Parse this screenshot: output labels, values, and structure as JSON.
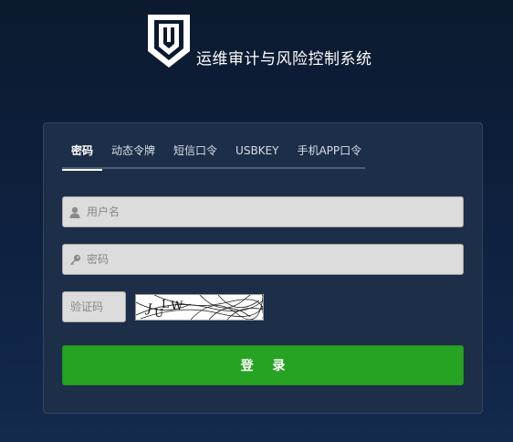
{
  "header": {
    "logo_icon": "shield-logo-icon",
    "title": "运维审计与风险控制系统"
  },
  "tabs": [
    {
      "label": "密码",
      "active": true
    },
    {
      "label": "动态令牌",
      "active": false
    },
    {
      "label": "短信口令",
      "active": false
    },
    {
      "label": "USBKEY",
      "active": false
    },
    {
      "label": "手机APP口令",
      "active": false
    }
  ],
  "form": {
    "username": {
      "placeholder": "用户名",
      "value": "",
      "icon": "user-icon"
    },
    "password": {
      "placeholder": "密码",
      "value": "",
      "icon": "key-icon"
    },
    "captcha": {
      "placeholder": "验证码",
      "value": "",
      "image_text": "JULW"
    },
    "submit_label": "登 录"
  },
  "colors": {
    "background": "#0e2140",
    "panel": "#1c2e48",
    "button": "#27a324",
    "input": "#dcdcdc"
  }
}
